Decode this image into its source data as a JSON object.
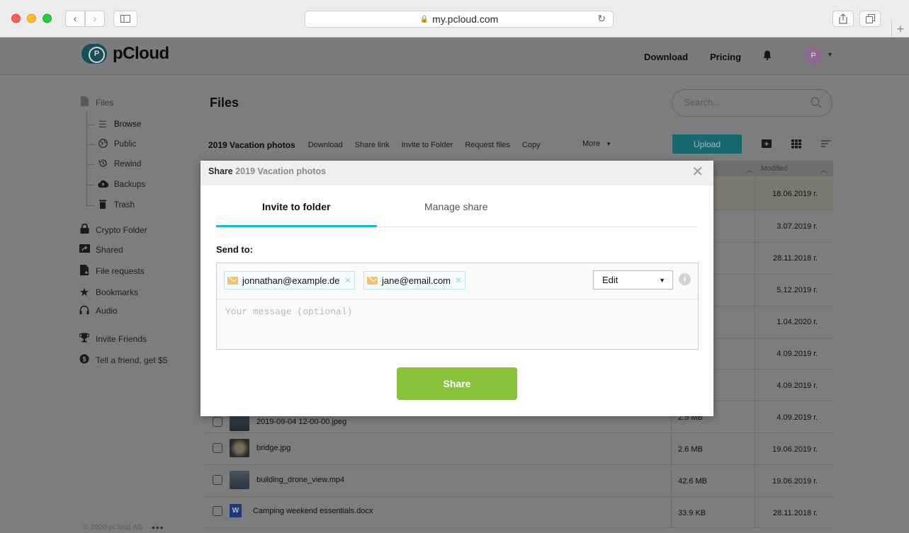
{
  "browser": {
    "url": "my.pcloud.com"
  },
  "header": {
    "brand": "pCloud",
    "download": "Download",
    "pricing": "Pricing",
    "avatar_initial": "P"
  },
  "sidebar": {
    "files": "Files",
    "browse": "Browse",
    "public": "Public",
    "rewind": "Rewind",
    "backups": "Backups",
    "trash": "Trash",
    "crypto": "Crypto Folder",
    "shared": "Shared",
    "file_requests": "File requests",
    "bookmarks": "Bookmarks",
    "audio": "Audio",
    "invite_friends": "Invite Friends",
    "tell_friend": "Tell a friend, get $5",
    "footer": "© 2020 pCloud AG",
    "footer_more": "•••"
  },
  "main": {
    "title": "Files",
    "search_placeholder": "Search...",
    "folder_name": "2019 Vacation photos",
    "toolbar": [
      "Download",
      "Share link",
      "Invite to Folder",
      "Request files",
      "Copy"
    ],
    "more": "More",
    "upload": "Upload",
    "col_modified": "Modified"
  },
  "dates": [
    "18.06.2019 г.",
    "3.07.2019 г.",
    "28.11.2018 г.",
    "5.12.2019 г.",
    "1.04.2020 г.",
    "4.09.2019 г.",
    "4.09.2019 г.",
    "4.09.2019 г.",
    "19.06.2019 г.",
    "19.06.2019 г.",
    "28.11.2018 г."
  ],
  "files": {
    "partial_name": "2019-09-04 12-00-00.jpeg",
    "partial_size": "2.5 MB",
    "bridge": {
      "name": "bridge.jpg",
      "size": "2.6 MB"
    },
    "drone": {
      "name": "building_drone_view.mp4",
      "size": "42.6 MB"
    },
    "camping": {
      "name": "Camping weekend essentials.docx",
      "size": "33.9 KB"
    },
    "word_letter": "W"
  },
  "modal": {
    "title_prefix": "Share",
    "title_folder": "2019 Vacation photos",
    "tab_invite": "Invite to folder",
    "tab_manage": "Manage share",
    "send_to": "Send to:",
    "recipients": [
      "jonnathan@example.de",
      "jane@email.com"
    ],
    "permission": "Edit",
    "message_placeholder": "Your message (optional)",
    "submit": "Share"
  },
  "colors": {
    "accent_teal": "#17b8c7",
    "share_green": "#88c33b",
    "upload_teal": "#17696f"
  }
}
